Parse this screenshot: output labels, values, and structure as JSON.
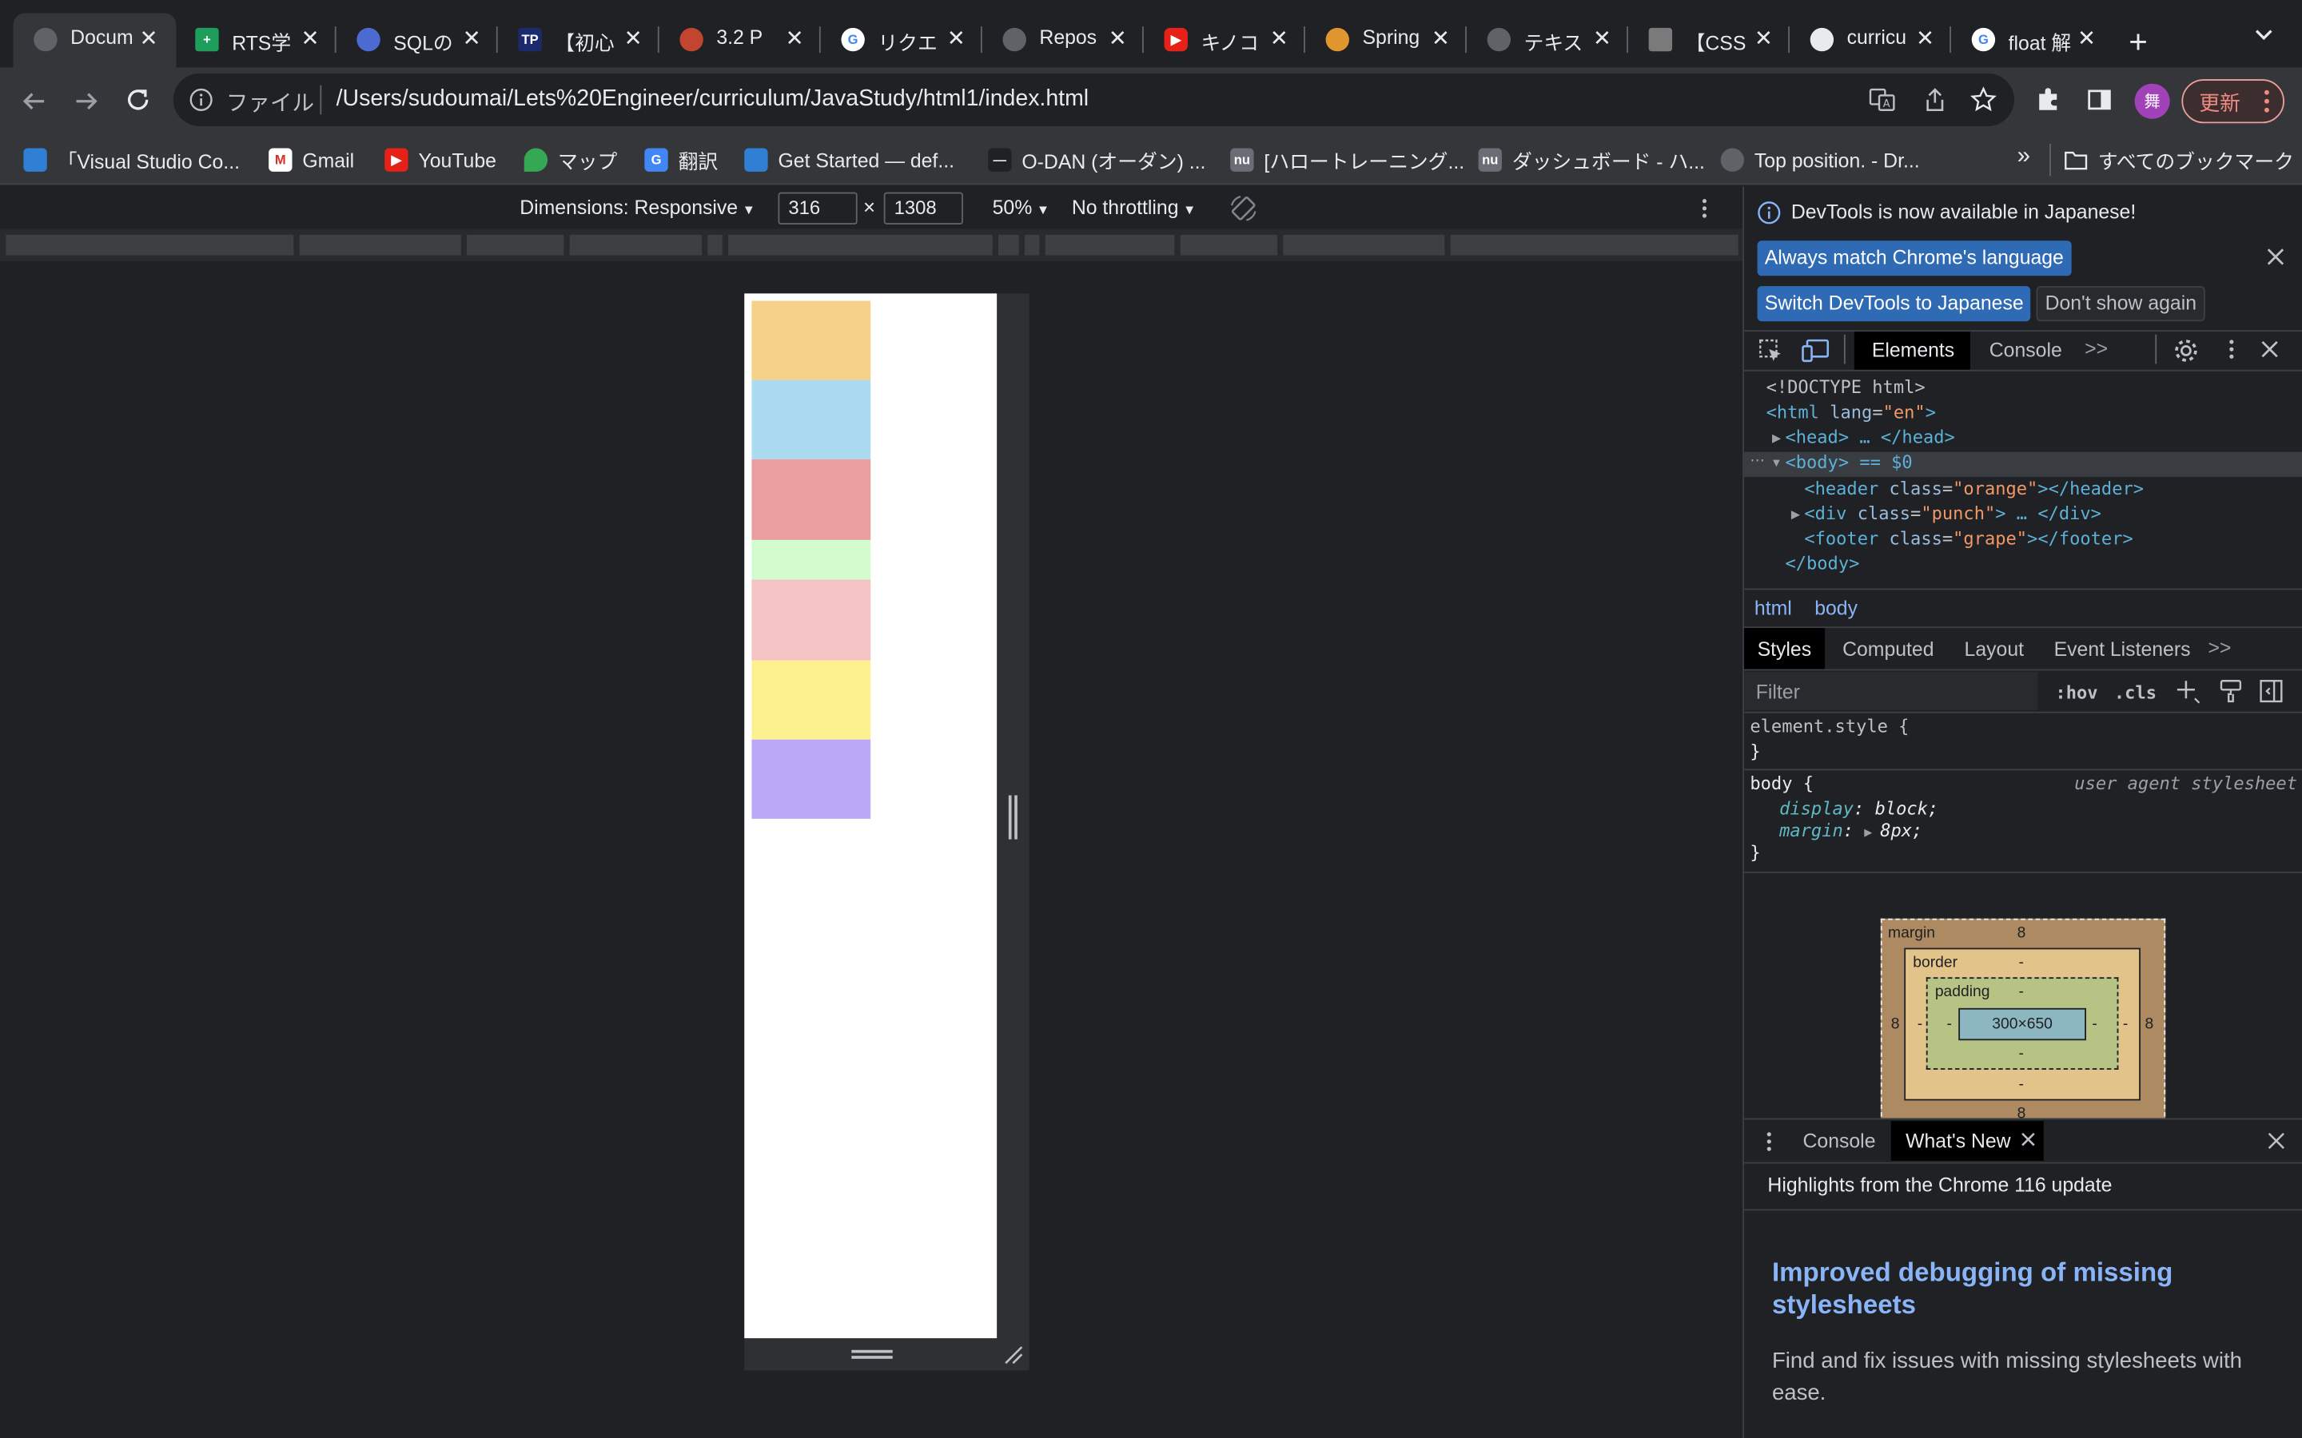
{
  "tabs": [
    {
      "title": "Docum",
      "icon": "globe-icon",
      "active": true
    },
    {
      "title": "RTS学",
      "icon": "sheets-icon"
    },
    {
      "title": "SQLの",
      "icon": "sql-icon"
    },
    {
      "title": "【初心",
      "icon": "tp-icon"
    },
    {
      "title": "3.2 P",
      "icon": "book-icon"
    },
    {
      "title": "リクエ",
      "icon": "google-icon"
    },
    {
      "title": "Repos",
      "icon": "globe-icon"
    },
    {
      "title": "キノコ",
      "icon": "youtube-icon"
    },
    {
      "title": "Spring",
      "icon": "spring-icon"
    },
    {
      "title": "テキス",
      "icon": "globe-icon"
    },
    {
      "title": "【CSS",
      "icon": "site-icon"
    },
    {
      "title": "curricu",
      "icon": "github-icon"
    },
    {
      "title": "float 解",
      "icon": "google-icon"
    }
  ],
  "toolbar": {
    "file_label": "ファイル",
    "url": "/Users/sudoumai/Lets%20Engineer/curriculum/JavaStudy/html1/index.html",
    "avatar_initial": "舞",
    "update_label": "更新"
  },
  "bookmarks": [
    {
      "label": "「Visual Studio Co...",
      "icon": "vscode-icon"
    },
    {
      "label": "Gmail",
      "icon": "gmail-icon"
    },
    {
      "label": "YouTube",
      "icon": "youtube-icon"
    },
    {
      "label": "マップ",
      "icon": "maps-icon"
    },
    {
      "label": "翻訳",
      "icon": "translate-icon"
    },
    {
      "label": "Get Started — def...",
      "icon": "vscode-icon"
    },
    {
      "label": "O-DAN (オーダン) ...",
      "icon": "odan-icon"
    },
    {
      "label": "[ハロートレーニング...",
      "icon": "nu-icon"
    },
    {
      "label": "ダッシュボード - ハ...",
      "icon": "nu-icon"
    },
    {
      "label": "Top position. - Dr...",
      "icon": "globe-icon"
    }
  ],
  "bookmarks_overflow": "»",
  "all_bookmarks_label": "すべてのブックマーク",
  "device_toolbar": {
    "dimensions_label": "Dimensions: Responsive",
    "width": "316",
    "times": "×",
    "height": "1308",
    "zoom": "50%",
    "throttling": "No throttling"
  },
  "page_boxes": [
    {
      "name": "orange-box",
      "color": "#f6d18a"
    },
    {
      "name": "blue-box",
      "color": "#aadbf0"
    },
    {
      "name": "red-box",
      "color": "#e99f9f"
    },
    {
      "name": "green-box",
      "color": "#d2fcce"
    },
    {
      "name": "pink-box",
      "color": "#f4c3c4"
    },
    {
      "name": "yellow-box",
      "color": "#fdf08f"
    },
    {
      "name": "purple-box",
      "color": "#bba9f7"
    }
  ],
  "devtools": {
    "infobar_text": "DevTools is now available in Japanese!",
    "btn_match": "Always match Chrome's language",
    "btn_switch": "Switch DevTools to Japanese",
    "btn_dont_show": "Don't show again",
    "tabs": [
      "Elements",
      "Console"
    ],
    "more_tabs": ">>",
    "dom_lines": [
      {
        "text": "<!DOCTYPE html>"
      },
      {
        "tag_open": "<html ",
        "attr": "lang",
        "eq": "=",
        "val": "\"en\"",
        "tag_close": ">"
      },
      {
        "text": "<head> … </head>"
      },
      {
        "text": "<body> == $0"
      },
      {
        "tag_open": "<header ",
        "attr": "class",
        "eq": "=",
        "val": "\"orange\"",
        "tag_close": "></header>"
      },
      {
        "tag_open": "<div ",
        "attr": "class",
        "eq": "=",
        "val": "\"punch\"",
        "tag_close": "> … </div>"
      },
      {
        "tag_open": "<footer ",
        "attr": "class",
        "eq": "=",
        "val": "\"grape\"",
        "tag_close": "></footer>"
      },
      {
        "text": "</body>"
      }
    ],
    "breadcrumbs": [
      "html",
      "body"
    ],
    "style_tabs": [
      "Styles",
      "Computed",
      "Layout",
      "Event Listeners"
    ],
    "filter_placeholder": "Filter",
    "hov": ":hov",
    "cls": ".cls",
    "element_style": "element.style {",
    "close_brace": "}",
    "body_rule": "body {",
    "ua_label": "user agent stylesheet",
    "display_prop": "display",
    "display_val": "block;",
    "margin_prop": "margin",
    "margin_val": "8px;",
    "box_model": {
      "margin_label": "margin",
      "margin_top": "8",
      "margin_left": "8",
      "margin_right": "8",
      "margin_bottom": "8",
      "border_label": "border",
      "border_val": "-",
      "padding_label": "padding",
      "padding_val": "-",
      "content": "300×650"
    },
    "drawer_tabs": [
      "Console",
      "What's New"
    ],
    "highlights": "Highlights from the Chrome 116 update",
    "article_title": "Improved debugging of missing stylesheets",
    "article_body": "Find and fix issues with missing stylesheets with ease."
  }
}
